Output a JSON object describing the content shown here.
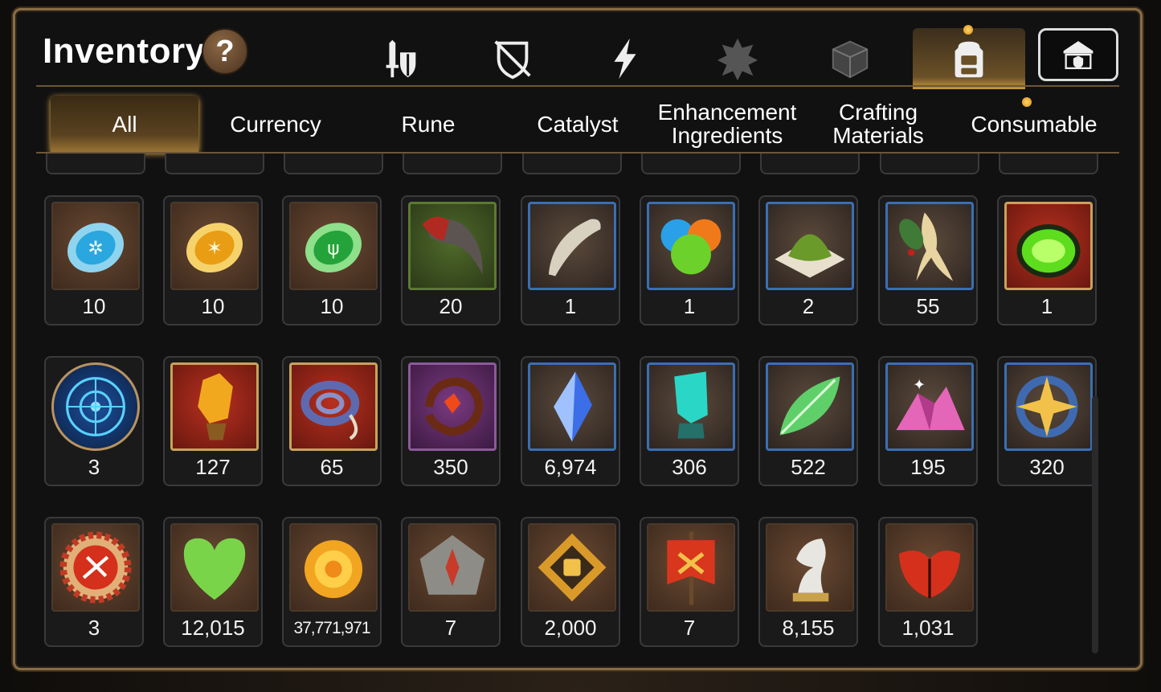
{
  "header": {
    "title": "Inventory",
    "help_label": "?"
  },
  "category_tabs": [
    {
      "icon": "sword-shield-icon",
      "active": false
    },
    {
      "icon": "broken-shield-icon",
      "active": false
    },
    {
      "icon": "lightning-icon",
      "active": false
    },
    {
      "icon": "emblem-icon",
      "active": false
    },
    {
      "icon": "cube-icon",
      "active": false
    },
    {
      "icon": "backpack-icon",
      "active": true
    },
    {
      "icon": "guild-hall-icon",
      "active": false
    }
  ],
  "subtabs": [
    {
      "label": "All",
      "active": true
    },
    {
      "label": "Currency",
      "active": false
    },
    {
      "label": "Rune",
      "active": false
    },
    {
      "label": "Catalyst",
      "active": false
    },
    {
      "label": "Enhancement Ingredients",
      "active": false
    },
    {
      "label": "Crafting Materials",
      "active": false
    },
    {
      "label": "Consumable",
      "active": false
    }
  ],
  "items": [
    {
      "icon": "blue-frost-rune-icon",
      "count": "10"
    },
    {
      "icon": "yellow-lightning-rune-icon",
      "count": "10"
    },
    {
      "icon": "green-nature-rune-icon",
      "count": "10"
    },
    {
      "icon": "claw-icon",
      "count": "20"
    },
    {
      "icon": "fang-icon",
      "count": "1"
    },
    {
      "icon": "slime-orbs-icon",
      "count": "1"
    },
    {
      "icon": "herb-powder-icon",
      "count": "2"
    },
    {
      "icon": "ginseng-root-icon",
      "count": "55"
    },
    {
      "icon": "green-potion-icon",
      "count": "1"
    },
    {
      "icon": "blue-magic-circle-icon",
      "count": "3"
    },
    {
      "icon": "amber-crystal-icon",
      "count": "127"
    },
    {
      "icon": "coiled-rope-icon",
      "count": "65"
    },
    {
      "icon": "red-charm-icon",
      "count": "350"
    },
    {
      "icon": "blue-gem-icon",
      "count": "6,974"
    },
    {
      "icon": "teal-crystal-icon",
      "count": "306"
    },
    {
      "icon": "green-leaf-icon",
      "count": "522"
    },
    {
      "icon": "pink-ore-icon",
      "count": "195"
    },
    {
      "icon": "star-pendant-icon",
      "count": "320"
    },
    {
      "icon": "battle-badge-icon",
      "count": "3"
    },
    {
      "icon": "green-heart-icon",
      "count": "12,015"
    },
    {
      "icon": "gold-coin-icon",
      "count": "37,771,971"
    },
    {
      "icon": "compass-stone-icon",
      "count": "7"
    },
    {
      "icon": "fist-emblem-icon",
      "count": "2,000"
    },
    {
      "icon": "war-banner-icon",
      "count": "7"
    },
    {
      "icon": "chess-knight-icon",
      "count": "8,155"
    },
    {
      "icon": "red-leaf-icon",
      "count": "1,031"
    }
  ],
  "colors": {
    "frame": "#8a6d45",
    "accent": "#f2b94a",
    "rare_border": "#3a6fb3",
    "epic_border": "#c9a25a"
  }
}
